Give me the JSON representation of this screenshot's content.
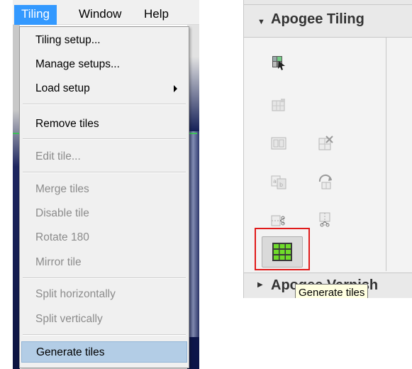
{
  "menubar": {
    "items": [
      {
        "label": "Tiling",
        "active": true
      },
      {
        "label": "Window"
      },
      {
        "label": "Help"
      }
    ]
  },
  "tiling_menu": {
    "items": [
      {
        "label": "Tiling setup...",
        "enabled": true
      },
      {
        "label": "Manage setups...",
        "enabled": true
      },
      {
        "label": "Load setup",
        "enabled": true,
        "submenu": true
      },
      {
        "label": "Remove tiles",
        "enabled": true
      },
      {
        "label": "Edit tile...",
        "enabled": false
      },
      {
        "label": "Merge tiles",
        "enabled": false
      },
      {
        "label": "Disable tile",
        "enabled": false
      },
      {
        "label": "Rotate 180",
        "enabled": false
      },
      {
        "label": "Mirror tile",
        "enabled": false
      },
      {
        "label": "Split horizontally",
        "enabled": false
      },
      {
        "label": "Split vertically",
        "enabled": false
      },
      {
        "label": "Generate tiles",
        "enabled": true,
        "highlighted": true
      }
    ]
  },
  "panel": {
    "section_title": "Apogee Tiling",
    "next_section_title": "Apogee Varnish",
    "tooltip": "Generate tiles",
    "tools": [
      {
        "icon": "tiling-setup-icon"
      },
      {
        "icon": "manage-setups-icon"
      },
      {
        "icon": "split-tile-icon"
      },
      {
        "icon": "remove-tiles-icon"
      },
      {
        "icon": "edit-tile-icon"
      },
      {
        "icon": "rotate-tile-icon"
      },
      {
        "icon": "cut-horizontal-icon"
      },
      {
        "icon": "cut-vertical-icon"
      },
      {
        "icon": "generate-tiles-icon"
      }
    ]
  },
  "colors": {
    "menu_active_bg": "#3399ff",
    "menu_highlight_bg": "#b3cde6",
    "disabled_text": "#8c8c8c",
    "highlight_border": "#e01a1a",
    "generate_icon_green": "#5fcf2f",
    "tooltip_bg": "#ffffe1"
  }
}
